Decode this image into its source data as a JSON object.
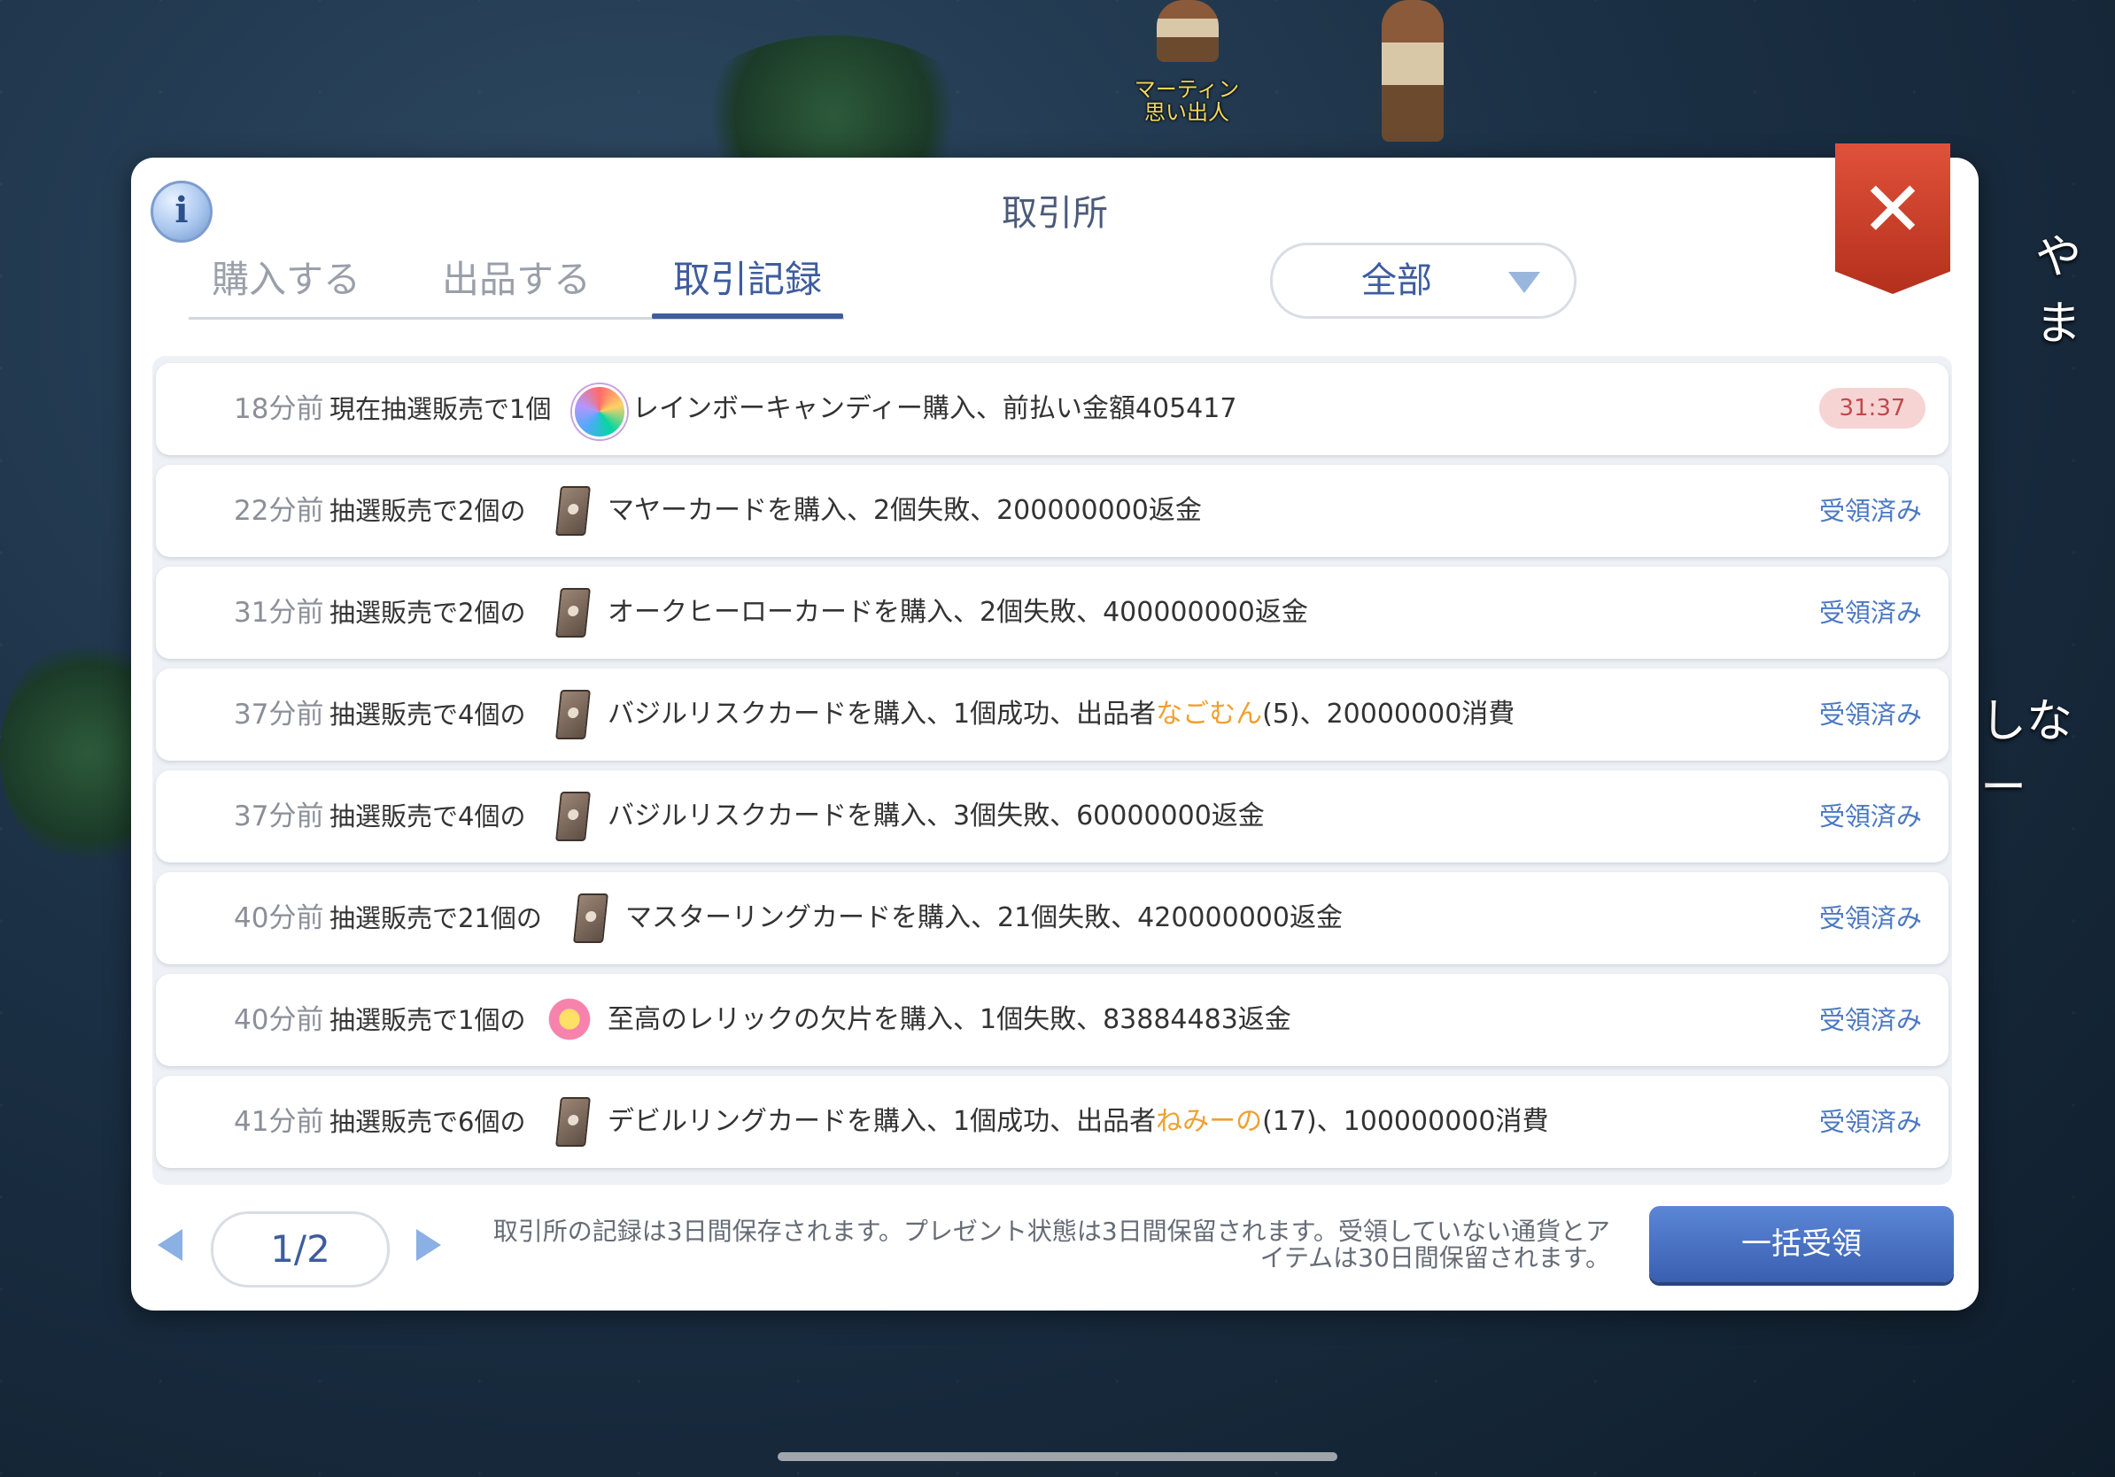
{
  "scene": {
    "npc_label_line1": "マーティン",
    "npc_label_line2": "思い出人",
    "side_text_top": "やま",
    "side_text_mid": "しなー"
  },
  "dialog": {
    "title": "取引所",
    "info_icon_glyph": "i",
    "close_glyph": "✕"
  },
  "tabs": [
    {
      "label": "購入する",
      "active": false
    },
    {
      "label": "出品する",
      "active": false
    },
    {
      "label": "取引記録",
      "active": true
    }
  ],
  "filter": {
    "selected": "全部"
  },
  "records": [
    {
      "time": "18分前",
      "prefix": "現在抽選販売で1個",
      "icon": "candy-icon",
      "desc": "レインボーキャンディー購入、前払い金額405417",
      "seller": "",
      "desc_after": "",
      "status": "",
      "timer": "31:37"
    },
    {
      "time": "22分前",
      "prefix": "抽選販売で2個の",
      "icon": "card-icon",
      "desc": "マヤーカードを購入、2個失敗、200000000返金",
      "seller": "",
      "desc_after": "",
      "status": "受領済み",
      "timer": ""
    },
    {
      "time": "31分前",
      "prefix": "抽選販売で2個の",
      "icon": "card-icon",
      "desc": "オークヒーローカードを購入、2個失敗、400000000返金",
      "seller": "",
      "desc_after": "",
      "status": "受領済み",
      "timer": ""
    },
    {
      "time": "37分前",
      "prefix": "抽選販売で4個の",
      "icon": "card-icon",
      "desc": "バジルリスクカードを購入、1個成功、出品者",
      "seller": "なごむん",
      "desc_after": "(5)、20000000消費",
      "status": "受領済み",
      "timer": ""
    },
    {
      "time": "37分前",
      "prefix": "抽選販売で4個の",
      "icon": "card-icon",
      "desc": "バジルリスクカードを購入、3個失敗、60000000返金",
      "seller": "",
      "desc_after": "",
      "status": "受領済み",
      "timer": ""
    },
    {
      "time": "40分前",
      "prefix": "抽選販売で21個の",
      "icon": "card-icon",
      "desc": "マスターリングカードを購入、21個失敗、420000000返金",
      "seller": "",
      "desc_after": "",
      "status": "受領済み",
      "timer": ""
    },
    {
      "time": "40分前",
      "prefix": "抽選販売で1個の",
      "icon": "relic-icon",
      "desc": "至高のレリックの欠片を購入、1個失敗、83884483返金",
      "seller": "",
      "desc_after": "",
      "status": "受領済み",
      "timer": ""
    },
    {
      "time": "41分前",
      "prefix": "抽選販売で6個の",
      "icon": "card-icon",
      "desc": "デビルリングカードを購入、1個成功、出品者",
      "seller": "ねみーの",
      "desc_after": "(17)、100000000消費",
      "status": "受領済み",
      "timer": ""
    }
  ],
  "footer": {
    "page": "1/2",
    "notice_line1": "取引所の記録は3日間保存されます。プレゼント状態は3日間保留されます。受領していない通貨とア",
    "notice_line2": "イテムは30日間保留されます。",
    "bulk_button": "一括受領"
  },
  "colors": {
    "accent": "#3e5c9e",
    "status_link": "#4b78c4",
    "seller_name": "#f0a030",
    "close_red": "#c8391f"
  }
}
